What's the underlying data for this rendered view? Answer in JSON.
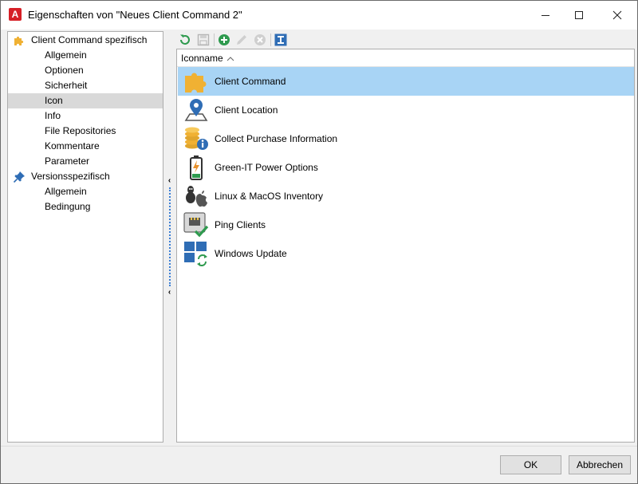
{
  "window": {
    "title": "Eigenschaften von \"Neues Client Command 2\"",
    "app_icon_letter": "A"
  },
  "tree": {
    "items": [
      {
        "label": "Client Command spezifisch",
        "level": 0,
        "icon": "puzzle-icon",
        "selected": false
      },
      {
        "label": "Allgemein",
        "level": 1,
        "selected": false
      },
      {
        "label": "Optionen",
        "level": 1,
        "selected": false
      },
      {
        "label": "Sicherheit",
        "level": 1,
        "selected": false
      },
      {
        "label": "Icon",
        "level": 1,
        "selected": true
      },
      {
        "label": "Info",
        "level": 1,
        "selected": false
      },
      {
        "label": "File Repositories",
        "level": 1,
        "selected": false
      },
      {
        "label": "Kommentare",
        "level": 1,
        "selected": false
      },
      {
        "label": "Parameter",
        "level": 1,
        "selected": false
      },
      {
        "label": "Versionsspezifisch",
        "level": 0,
        "icon": "pin-icon",
        "selected": false
      },
      {
        "label": "Allgemein",
        "level": 1,
        "selected": false
      },
      {
        "label": "Bedingung",
        "level": 1,
        "selected": false
      }
    ]
  },
  "toolbar": {
    "buttons": [
      "refresh-icon",
      "save-icon",
      "add-icon",
      "edit-icon",
      "delete-icon",
      "rename-icon"
    ]
  },
  "list": {
    "column_header": "Iconname",
    "sort": "ascending",
    "rows": [
      {
        "label": "Client Command",
        "icon": "puzzle-icon",
        "selected": true
      },
      {
        "label": "Client Location",
        "icon": "location-pin-icon",
        "selected": false
      },
      {
        "label": "Collect Purchase Information",
        "icon": "coins-info-icon",
        "selected": false
      },
      {
        "label": "Green-IT Power Options",
        "icon": "battery-bolt-icon",
        "selected": false
      },
      {
        "label": "Linux & MacOS Inventory",
        "icon": "linux-apple-icon",
        "selected": false
      },
      {
        "label": "Ping Clients",
        "icon": "network-check-icon",
        "selected": false
      },
      {
        "label": "Windows Update",
        "icon": "windows-update-icon",
        "selected": false
      }
    ]
  },
  "buttons": {
    "ok": "OK",
    "cancel": "Abbrechen"
  },
  "colors": {
    "selection_row": "#a8d4f5",
    "tree_selection": "#d9d9d9",
    "puzzle": "#f0b133",
    "accent_blue": "#2f6db5",
    "green": "#2e9a4e"
  }
}
